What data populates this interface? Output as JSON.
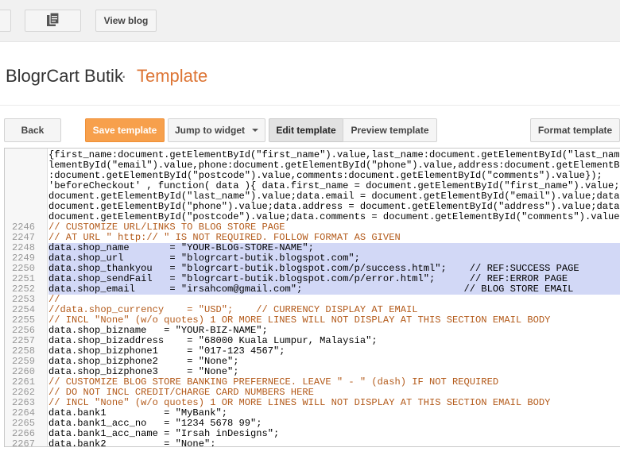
{
  "topbar": {
    "view_blog": "View blog",
    "copy_icon": "copy-document-icon"
  },
  "header": {
    "blog_name": "BlogrCart Butik",
    "separator": "·",
    "page": "Template"
  },
  "toolbar": {
    "back": "Back",
    "save": "Save template",
    "jump": "Jump to widget",
    "edit": "Edit template",
    "preview": "Preview template",
    "format": "Format template"
  },
  "colors": {
    "accent": "#dd7535",
    "save_button": "#f7a04c",
    "highlight": "#d2d8f6"
  },
  "editor": {
    "lines": [
      {
        "num": "",
        "hl": false,
        "text": "{first_name:document.getElementById(\"first_name\").value,last_name:document.getElementById(\"last_name\").value,email:document.get"
      },
      {
        "num": "",
        "hl": false,
        "text": "lementById(\"email\").value,phone:document.getElementById(\"phone\").value,address:document.getElementById(\"address\").value,postcode"
      },
      {
        "num": "",
        "hl": false,
        "text": ":document.getElementById(\"postcode\").value,comments:document.getElementById(\"comments\").value});"
      },
      {
        "num": "",
        "hl": false,
        "text": "'beforeCheckout' , function( data ){ data.first_name = document.getElementById(\"first_name\").value;data.last_name ="
      },
      {
        "num": "",
        "hl": false,
        "text": "document.getElementById(\"last_name\").value;data.email = document.getElementById(\"email\").value;data.phone ="
      },
      {
        "num": "",
        "hl": false,
        "text": "document.getElementById(\"phone\").value;data.address = document.getElementById(\"address\").value;data.postcode ="
      },
      {
        "num": "",
        "hl": false,
        "text": "document.getElementById(\"postcode\").value;data.comments = document.getElementById(\"comments\").value;"
      },
      {
        "num": "2246",
        "hl": false,
        "text": "// CUSTOMIZE URL/LINKS TO BLOG STORE PAGE"
      },
      {
        "num": "2247",
        "hl": false,
        "text": "// AT URL \" http:// \" IS NOT REQUIRED. FOLLOW FORMAT AS GIVEN"
      },
      {
        "num": "2248",
        "hl": true,
        "text": "data.shop_name       = \"YOUR-BLOG-STORE-NAME\";"
      },
      {
        "num": "2249",
        "hl": true,
        "text": "data.shop_url        = \"blogrcart-butik.blogspot.com\";"
      },
      {
        "num": "2250",
        "hl": true,
        "text": "data.shop_thankyou   = \"blogrcart-butik.blogspot.com/p/success.html\";    // REF:SUCCESS PAGE"
      },
      {
        "num": "2251",
        "hl": true,
        "text": "data.shop_sendFail   = \"blogrcart-butik.blogspot.com/p/error.html\";      // REF:ERROR PAGE"
      },
      {
        "num": "2252",
        "hl": true,
        "text": "data.shop_email      = \"irsahcom@gmail.com\";                            // BLOG STORE EMAIL"
      },
      {
        "num": "2253",
        "hl": false,
        "text": "//"
      },
      {
        "num": "2254",
        "hl": false,
        "text": "//data.shop_currency    = \"USD\";    // CURRENCY DISPLAY AT EMAIL"
      },
      {
        "num": "2255",
        "hl": false,
        "text": "// INCL \"None\" (w/o quotes) 1 OR MORE LINES WILL NOT DISPLAY AT THIS SECTION EMAIL BODY"
      },
      {
        "num": "2256",
        "hl": false,
        "text": "data.shop_bizname   = \"YOUR-BIZ-NAME\";"
      },
      {
        "num": "2257",
        "hl": false,
        "text": "data.shop_bizaddress    = \"68000 Kuala Lumpur, Malaysia\";"
      },
      {
        "num": "2258",
        "hl": false,
        "text": "data.shop_bizphone1     = \"017-123 4567\";"
      },
      {
        "num": "2259",
        "hl": false,
        "text": "data.shop_bizphone2     = \"None\";"
      },
      {
        "num": "2260",
        "hl": false,
        "text": "data.shop_bizphone3     = \"None\";"
      },
      {
        "num": "2261",
        "hl": false,
        "text": "// CUSTOMIZE BLOG STORE BANKING PREFERNECE. LEAVE \" - \" (dash) IF NOT REQUIRED"
      },
      {
        "num": "2262",
        "hl": false,
        "text": "// DO NOT INCL CREDIT/CHARGE CARD NUMBERS HERE"
      },
      {
        "num": "2263",
        "hl": false,
        "text": "// INCL \"None\" (w/o quotes) 1 OR MORE LINES WILL NOT DISPLAY AT THIS SECTION EMAIL BODY"
      },
      {
        "num": "2264",
        "hl": false,
        "text": "data.bank1          = \"MyBank\";"
      },
      {
        "num": "2265",
        "hl": false,
        "text": "data.bank1_acc_no   = \"1234 5678 99\";"
      },
      {
        "num": "2266",
        "hl": false,
        "text": "data.bank1_acc_name = \"Irsah inDesigns\";"
      },
      {
        "num": "2267",
        "hl": false,
        "text": "data.bank2          = \"None\";"
      }
    ]
  }
}
